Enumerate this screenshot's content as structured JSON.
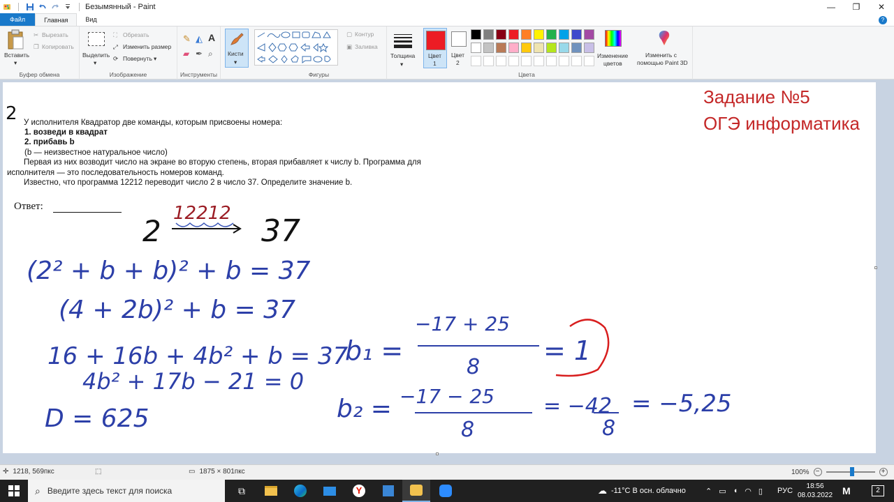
{
  "window": {
    "title": "Безымянный - Paint",
    "controls": {
      "minimize": "—",
      "maximize": "❐",
      "close": "✕"
    }
  },
  "tabs": {
    "file": "Файл",
    "home": "Главная",
    "view": "Вид"
  },
  "ribbon": {
    "clipboard": {
      "paste": "Вставить",
      "cut": "Вырезать",
      "copy": "Копировать",
      "group": "Буфер обмена"
    },
    "image": {
      "select": "Выделить",
      "crop": "Обрезать",
      "resize": "Изменить размер",
      "rotate": "Повернуть",
      "group": "Изображение"
    },
    "tools": {
      "group": "Инструменты"
    },
    "brushes": {
      "label": "Кисти"
    },
    "shapes": {
      "outline": "Контур",
      "fill": "Заливка",
      "group": "Фигуры"
    },
    "size": {
      "label": "Толщина"
    },
    "colors": {
      "color1_line1": "Цвет",
      "color1_line2": "1",
      "color2_line1": "Цвет",
      "color2_line2": "2",
      "edit_line1": "Изменение",
      "edit_line2": "цветов",
      "paint3d_line1": "Изменить с",
      "paint3d_line2": "помощью Paint 3D",
      "group": "Цвета",
      "color1_value": "#ec1c24",
      "color2_value": "#ffffff",
      "palette_row1": [
        "#000000",
        "#7f7f7f",
        "#880015",
        "#ed1c24",
        "#ff7f27",
        "#fff200",
        "#22b14c",
        "#00a2e8",
        "#3f48cc",
        "#a349a4"
      ],
      "palette_row2": [
        "#ffffff",
        "#c3c3c3",
        "#b97a57",
        "#ffaec9",
        "#ffc90e",
        "#efe4b0",
        "#b5e61d",
        "#99d9ea",
        "#7092be",
        "#c8bfe7"
      ]
    }
  },
  "document": {
    "number": "2",
    "line1": "У исполнителя Квадратор две команды, которым присвоены номера:",
    "cmd1": "1. возведи в квадрат",
    "cmd2": "2. прибавь b",
    "note": "(b — неизвестное натуральное число)",
    "para1": "Первая из них возводит число на экране во вторую степень, вторая прибавляет к числу b. Программа для",
    "para2": "исполнителя — это последовательность номеров команд.",
    "para3": "Известно, что программа 12212 переводит число 2 в число 37. Определите значение b.",
    "answer": "Ответ:",
    "heading1": "Задание №5",
    "heading2": "ОГЭ информатика"
  },
  "handwriting": {
    "program": "12212",
    "start": "2",
    "result": "37",
    "eq1": "(2² + b + b)² + b = 37",
    "eq2": "(4 + 2b)² + b = 37",
    "eq3": "16 + 16b + 4b² + b = 37",
    "eq4": "4b² + 17b − 21 = 0",
    "disc": "D = 625",
    "root1_lhs": "b₁ =",
    "root1_num": "−17 + 25",
    "root1_den": "8",
    "root1_val": "= 1",
    "root2_lhs": "b₂ =",
    "root2_num": "−17 − 25",
    "root2_den": "8",
    "root2_mid": "= −42",
    "root2_mid_den": "8",
    "root2_val": "= −5,25"
  },
  "statusbar": {
    "cursor": "1218, 569пкс",
    "size": "1875 × 801пкс",
    "zoom": "100%",
    "zoom_minus": "−",
    "zoom_plus": "+"
  },
  "taskbar": {
    "search_placeholder": "Введите здесь текст для поиска",
    "weather": "-11°C  В осн. облачно",
    "lang": "РУС",
    "time": "18:56",
    "date": "08.03.2022",
    "notif": "2"
  }
}
